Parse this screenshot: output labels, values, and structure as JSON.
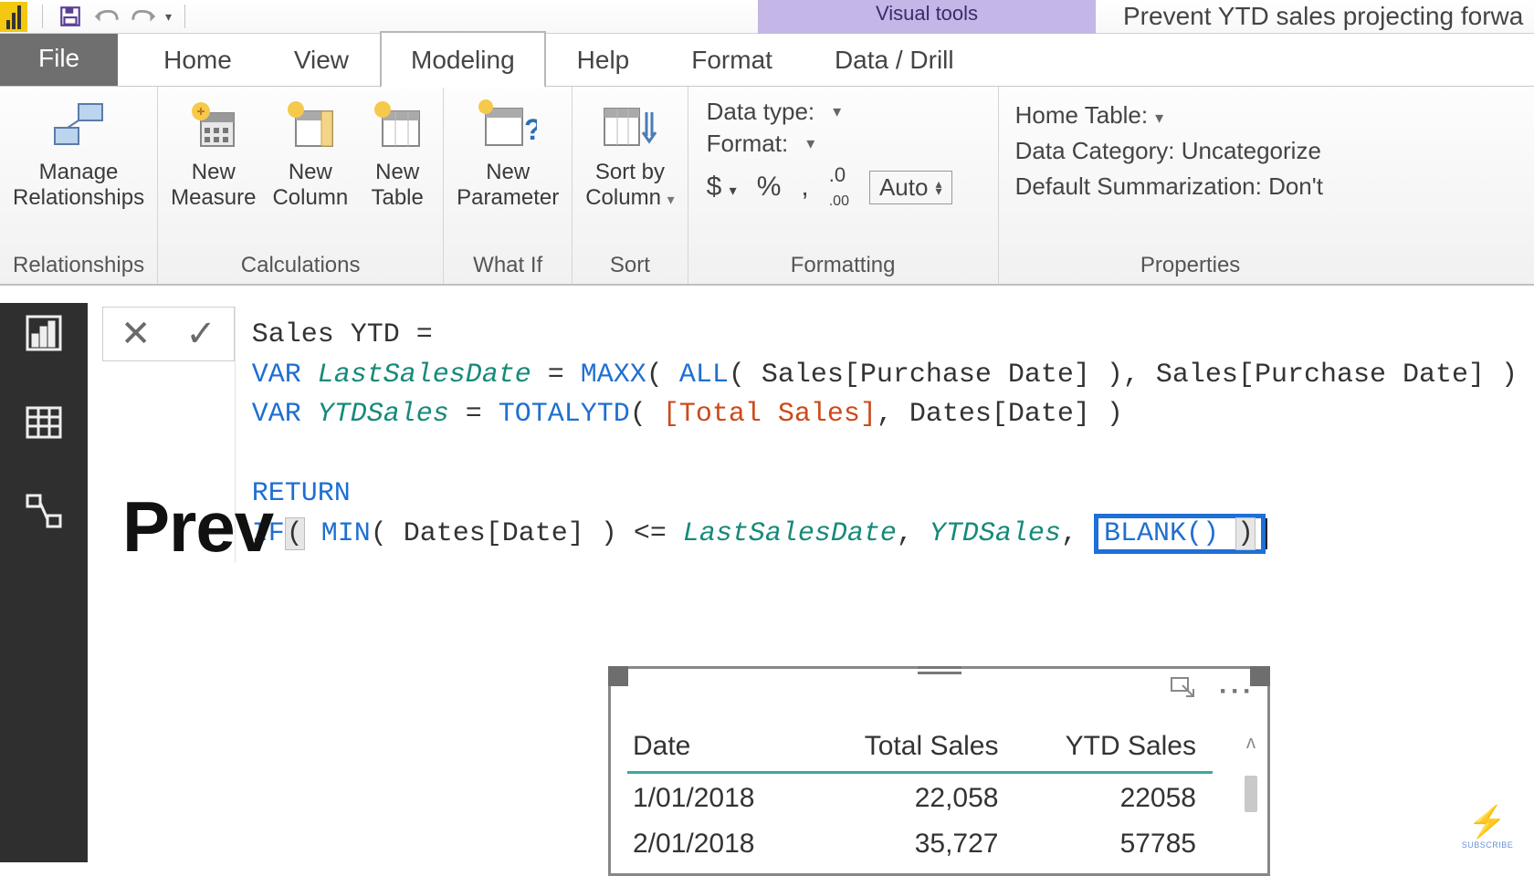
{
  "app": {
    "visual_tools_label": "Visual tools",
    "document_title": "Prevent YTD sales projecting forwa"
  },
  "tabs": {
    "file": "File",
    "home": "Home",
    "view": "View",
    "modeling": "Modeling",
    "help": "Help",
    "format": "Format",
    "data_drill": "Data / Drill"
  },
  "ribbon": {
    "relationships": {
      "manage": "Manage\nRelationships",
      "group": "Relationships"
    },
    "calculations": {
      "new_measure": "New\nMeasure",
      "new_column": "New\nColumn",
      "new_table": "New\nTable",
      "group": "Calculations"
    },
    "whatif": {
      "new_parameter": "New\nParameter",
      "group": "What If"
    },
    "sort": {
      "sort_by_column": "Sort by\nColumn",
      "group": "Sort"
    },
    "formatting": {
      "data_type": "Data type:",
      "format": "Format:",
      "auto": "Auto",
      "group": "Formatting"
    },
    "properties": {
      "home_table": "Home Table:",
      "data_category": "Data Category: Uncategorize",
      "default_summ": "Default Summarization: Don't",
      "group": "Properties"
    }
  },
  "formula": {
    "line1_name": "Sales YTD",
    "var1": "LastSalesDate",
    "maxx": "MAXX",
    "all": "ALL",
    "sales_purchase": "Sales[Purchase Date]",
    "var2": "YTDSales",
    "totalytd": "TOTALYTD",
    "total_sales_meas": "[Total Sales]",
    "dates_date": "Dates[Date]",
    "return": "RETURN",
    "if": "IF",
    "min": "MIN",
    "blank": "BLANK()"
  },
  "canvas_title_cut": "Prev",
  "table": {
    "headers": [
      "Date",
      "Total Sales",
      "YTD Sales"
    ],
    "rows": [
      [
        "1/01/2018",
        "22,058",
        "22058"
      ],
      [
        "2/01/2018",
        "35,727",
        "57785"
      ]
    ]
  },
  "subscribe": "SUBSCRIBE"
}
